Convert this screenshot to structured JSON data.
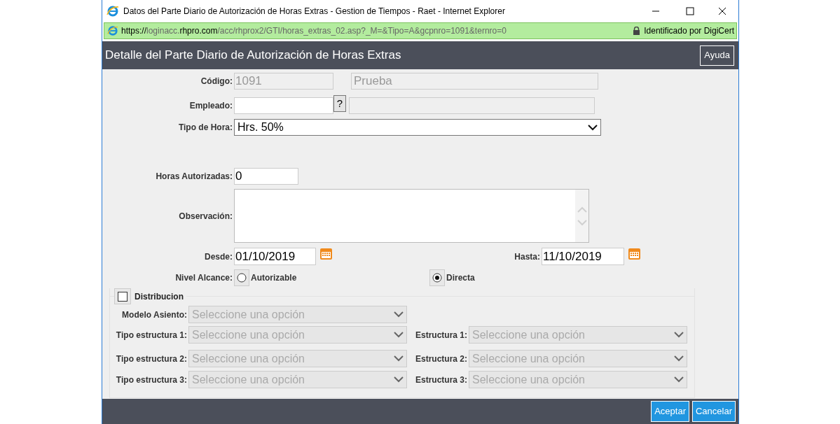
{
  "window": {
    "title": "Datos del Parte Diario de Autorización de Horas Extras - Gestion de Tiempos - Raet - Internet Explorer"
  },
  "address_bar": {
    "url": [
      {
        "text": "https://",
        "strong": true
      },
      {
        "text": "loginacc.",
        "strong": false
      },
      {
        "text": "rhpro.com",
        "strong": true
      },
      {
        "text": "/acc/rhprox2/GTI/horas_extras_02.asp?_M=&Tipo=A&gcpnro=1091&ternro=0",
        "strong": false
      }
    ],
    "security": "Identificado por DigiCert"
  },
  "header": {
    "title": "Detalle del Parte Diario de Autorización de Horas Extras",
    "help_button": "Ayuda"
  },
  "form": {
    "codigo": {
      "label": "Código:",
      "value": "1091",
      "description": "Prueba"
    },
    "empleado": {
      "label": "Empleado:",
      "lookup_button": "?"
    },
    "tipo_hora": {
      "label": "Tipo de Hora:",
      "value": "Hrs. 50%"
    },
    "horas_autorizadas": {
      "label": "Horas Autorizadas:",
      "value": "0"
    },
    "observacion": {
      "label": "Observación:"
    },
    "desde": {
      "label": "Desde:",
      "value": "01/10/2019"
    },
    "hasta": {
      "label": "Hasta:",
      "value": "11/10/2019"
    },
    "nivel_alcance": {
      "label": "Nivel Alcance:",
      "options": [
        {
          "label": "Autorizable",
          "selected": false
        },
        {
          "label": "Directa",
          "selected": true
        }
      ]
    }
  },
  "distribucion": {
    "label": "Distribucion",
    "checked": false,
    "modelo_asiento": {
      "label": "Modelo Asiento:",
      "value": "Seleccione una opción",
      "disabled": true
    },
    "rows": [
      {
        "tipo": {
          "label": "Tipo estructura 1:",
          "value": "Seleccione una opción",
          "disabled": true
        },
        "estructura": {
          "label": "Estructura 1:",
          "value": "Seleccione una opción",
          "disabled": true
        }
      },
      {
        "tipo": {
          "label": "Tipo estructura 2:",
          "value": "Seleccione una opción",
          "disabled": true
        },
        "estructura": {
          "label": "Estructura 2:",
          "value": "Seleccione una opción",
          "disabled": true
        }
      },
      {
        "tipo": {
          "label": "Tipo estructura 3:",
          "value": "Seleccione una opción",
          "disabled": true
        },
        "estructura": {
          "label": "Estructura 3:",
          "value": "Seleccione una opción",
          "disabled": true
        }
      }
    ]
  },
  "footer": {
    "buttons": [
      "Aceptar",
      "Cancelar"
    ]
  }
}
